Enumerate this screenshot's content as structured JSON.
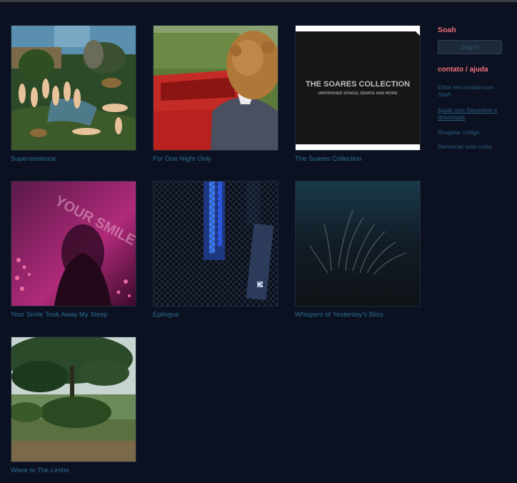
{
  "albums": [
    {
      "title": "Supervenience",
      "art": "painting"
    },
    {
      "title": "For One Night Only",
      "art": "curly-hair-car"
    },
    {
      "title": "The Soares Collection",
      "art": "text-cover",
      "cover_line1": "THE SOARES COLLECTION",
      "cover_line2": "UNFINISHED SONGS, DEMOS AND MORE"
    },
    {
      "title": "Your Smile Took Away My Sleep",
      "art": "pink-silhouette",
      "cover_text": "YOUR SMILE TOOK AWAY MY SLEEP"
    },
    {
      "title": "Epilogue",
      "art": "blue-fence"
    },
    {
      "title": "Whispers of Yesterday's Bliss",
      "art": "dark-grass"
    },
    {
      "title": "Wave to The Limbo",
      "art": "tree-field"
    }
  ],
  "sidebar": {
    "artist_name": "Soah",
    "follow_label": "Seguir",
    "contact_heading": "contato / ajuda",
    "links": {
      "contact": "Entre em contato com Soah",
      "help": "Ajuda com Streaming e downloads",
      "redeem": "Resgatar código",
      "report": "Denunciar esta conta"
    }
  },
  "colors": {
    "background": "#0b1120",
    "link": "#2b6f94",
    "accent": "#f0707c"
  }
}
